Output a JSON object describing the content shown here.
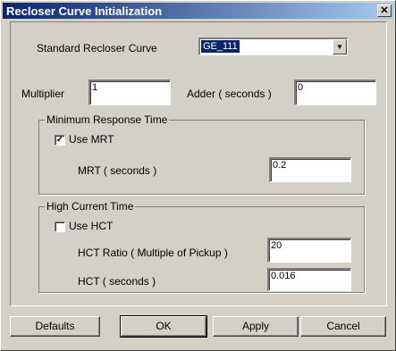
{
  "window": {
    "title": "Recloser Curve Initialization",
    "close_glyph": "✕"
  },
  "standard_curve": {
    "label": "Standard Recloser Curve",
    "value": "GE_111"
  },
  "multiplier": {
    "label": "Multiplier",
    "value": "1"
  },
  "adder": {
    "label": "Adder ( seconds )",
    "value": "0"
  },
  "mrt": {
    "group_title": "Minimum Response Time",
    "use_label": "Use MRT",
    "use_checked": true,
    "seconds_label": "MRT  ( seconds )",
    "seconds_value": "0.2"
  },
  "hct": {
    "group_title": "High Current Time",
    "use_label": "Use HCT",
    "use_checked": false,
    "ratio_label": "HCT Ratio  ( Multiple of Pickup )",
    "ratio_value": "20",
    "seconds_label": "HCT  ( seconds )",
    "seconds_value": "0.016"
  },
  "buttons": {
    "defaults": "Defaults",
    "ok": "OK",
    "apply": "Apply",
    "cancel": "Cancel"
  },
  "checkmark_glyph": "✓",
  "dropdown_glyph": "▼"
}
